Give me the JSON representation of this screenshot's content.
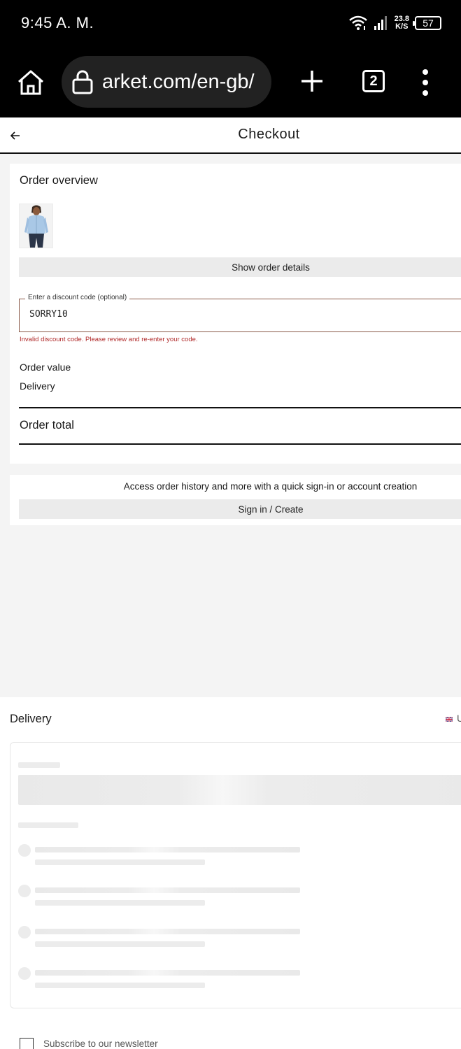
{
  "status_bar": {
    "time": "9:45 A. M.",
    "net_speed_value": "23.8",
    "net_speed_unit": "K/S",
    "battery": "57"
  },
  "browser": {
    "url": "arket.com/en-gb/",
    "tab_count": "2",
    "icons": [
      "home-icon",
      "lock-icon",
      "plus-icon",
      "more-vert-icon"
    ]
  },
  "header": {
    "title": "Checkout",
    "back_icon": "arrow-left-icon"
  },
  "order_overview": {
    "heading": "Order overview",
    "show_details_label": "Show order details",
    "discount_label": "Enter a discount code (optional)",
    "discount_value": "SORRY10",
    "discount_error": "Invalid discount code. Please review and re-enter your code.",
    "order_value_label": "Order value",
    "delivery_label": "Delivery",
    "order_total_label": "Order total"
  },
  "account": {
    "message": "Access order history and more with a quick sign-in or account creation",
    "button_label": "Sign in / Create"
  },
  "delivery": {
    "title": "Delivery",
    "country_fragment": "U",
    "loading": true
  },
  "newsletter": {
    "label": "Subscribe to our newsletter",
    "checked": false
  },
  "colors": {
    "error": "#b02a2a",
    "button_bg": "#ebebeb",
    "page_bg": "#f4f4f4",
    "chrome_bg": "#000000"
  }
}
